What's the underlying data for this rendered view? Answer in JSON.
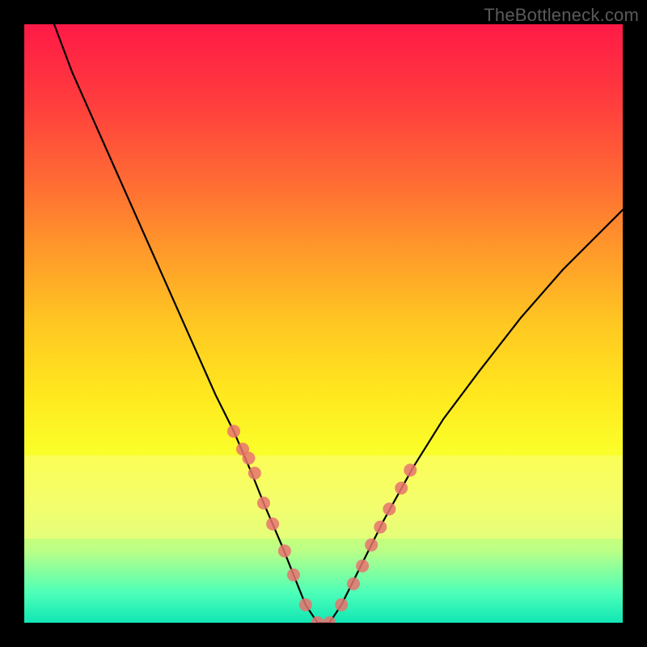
{
  "watermark": "TheBottleneck.com",
  "chart_data": {
    "type": "line",
    "title": "",
    "xlabel": "",
    "ylabel": "",
    "xlim": [
      0,
      100
    ],
    "ylim": [
      0,
      100
    ],
    "series": [
      {
        "name": "curve",
        "x": [
          5,
          8,
          12,
          16,
          20,
          24,
          28,
          32,
          35,
          38,
          40,
          43,
          45,
          47,
          49,
          51,
          53,
          56,
          60,
          65,
          70,
          76,
          83,
          90,
          97,
          100
        ],
        "y": [
          100,
          92,
          83,
          74,
          65,
          56,
          47,
          38,
          32,
          25,
          20,
          13,
          8,
          3,
          0,
          0,
          3,
          9,
          17,
          26,
          34,
          42,
          51,
          59,
          66,
          69
        ]
      }
    ],
    "markers": {
      "name": "dots",
      "color": "#e7736f",
      "radius_px": 8,
      "x": [
        35.0,
        36.5,
        37.5,
        38.5,
        40.0,
        41.5,
        43.5,
        45.0,
        47.0,
        49.0,
        51.0,
        53.0,
        55.0,
        56.5,
        58.0,
        59.5,
        61.0,
        63.0,
        64.5
      ],
      "y": [
        32.0,
        29.0,
        27.5,
        25.0,
        20.0,
        16.5,
        12.0,
        8.0,
        3.0,
        0.0,
        0.0,
        3.0,
        6.5,
        9.5,
        13.0,
        16.0,
        19.0,
        22.5,
        25.5
      ]
    },
    "annotations": []
  }
}
